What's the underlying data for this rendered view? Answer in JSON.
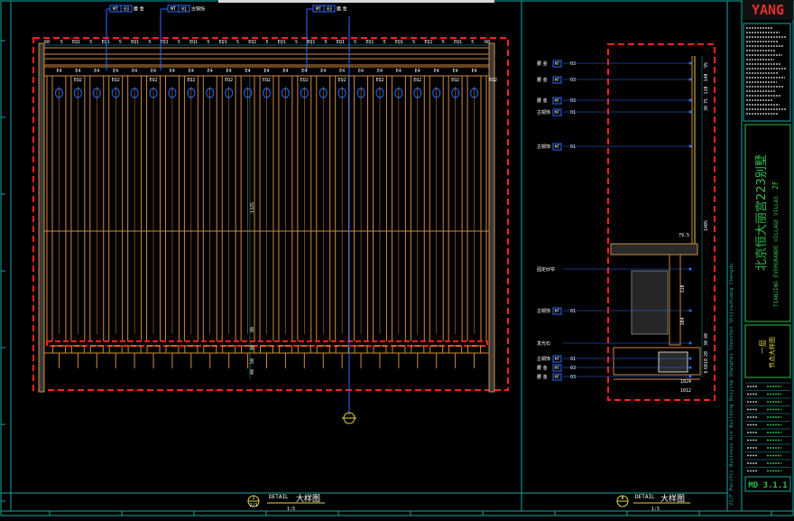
{
  "colors": {
    "background": "#000000",
    "frame": "#1aa6a6",
    "red_dashed": "#ff2020",
    "wood": "#d08a40",
    "blue_leader": "#2a6cff",
    "callout_text": "#ffffff",
    "title_green": "#2fbf4a",
    "yellow_text": "#e8d23a",
    "magenta": "#d040d0",
    "logo_red": "#e03030"
  },
  "top_tags": [
    {
      "id": "t1",
      "code": "MT",
      "num": "03",
      "extra": "腰 金"
    },
    {
      "id": "t2",
      "code": "MT",
      "num": "01",
      "extra": "古铜饰"
    },
    {
      "id": "t3",
      "code": "MT",
      "num": "03",
      "extra": "腰 金"
    }
  ],
  "top_dims": [
    "60",
    "5",
    "EQ1",
    "5",
    "EQ1",
    "5",
    "EQ1",
    "5",
    "EQ1",
    "5",
    "EQ1",
    "5",
    "EQ1",
    "5",
    "EQ1",
    "5",
    "EQ1",
    "5",
    "EQ1",
    "5",
    "EQ1",
    "5",
    "EQ1",
    "5",
    "EQ1",
    "5",
    "EQ1",
    "5",
    "EQ1",
    "5",
    "60"
  ],
  "mid_labels": [
    "E4",
    "E4",
    "E4",
    "E4",
    "E4",
    "E4",
    "E4",
    "E4",
    "E4",
    "E4",
    "E4",
    "E4",
    "E4",
    "E4",
    "E4",
    "E4",
    "E4",
    "E4",
    "E4",
    "E4",
    "E4",
    "E4",
    "E4"
  ],
  "eq_labels": [
    "EQ2",
    "EQ2",
    "EQ2",
    "EQ2",
    "EQ2",
    "EQ2",
    "EQ2",
    "EQ2",
    "EQ2",
    "EQ2",
    "EQ2",
    "EQ2"
  ],
  "vertical_dims": [
    "1325",
    "80",
    "40",
    "50",
    "40"
  ],
  "section_callouts": [
    {
      "label": "腰 金",
      "code": "MT",
      "num": "03"
    },
    {
      "label": "腰 金",
      "code": "MT",
      "num": "03"
    },
    {
      "label": "腰 金",
      "code": "MT",
      "num": "03"
    },
    {
      "label": "古铜饰",
      "code": "MT",
      "num": "01"
    },
    {
      "label": "古铜饰",
      "code": "MT",
      "num": "01"
    },
    {
      "label": "固定纱帘",
      "code": "",
      "num": ""
    },
    {
      "label": "古铜饰",
      "code": "MT",
      "num": "01"
    },
    {
      "label": "发光石",
      "code": "",
      "num": ""
    },
    {
      "label": "古铜饰",
      "code": "MT",
      "num": "01"
    },
    {
      "label": "腰 金",
      "code": "MT",
      "num": "03"
    },
    {
      "label": "腰 金",
      "code": "MT",
      "num": "03"
    }
  ],
  "section_dims": [
    "95",
    "140",
    "110",
    "75",
    "30",
    "1405",
    "79.5",
    "310",
    "104",
    "40",
    "30",
    "20",
    "10",
    "60",
    "6",
    "1024",
    "1012"
  ],
  "details": [
    {
      "id": "1",
      "title": "DETAIL",
      "name": "大样图",
      "scale": "1:5",
      "sheet": "2/1"
    },
    {
      "id": "A",
      "title": "DETAIL",
      "name": "大样图",
      "scale": "1:5",
      "sheet": ""
    }
  ],
  "title_block": {
    "logo": "YANG",
    "project_cn": "北京恒大丽宫223别墅",
    "project_en": "TIANJING EVERGRANDE VILLAGE VILLAS",
    "floor": "2F",
    "drawing_cn": "一层",
    "drawing_sub": "节点大样图",
    "drawing_no": "MD 3.1.1",
    "side_text": "21/F Pacific Business Gre Building Beijing Shanghai Shenzhen Shijiazhuang Chengdu"
  }
}
